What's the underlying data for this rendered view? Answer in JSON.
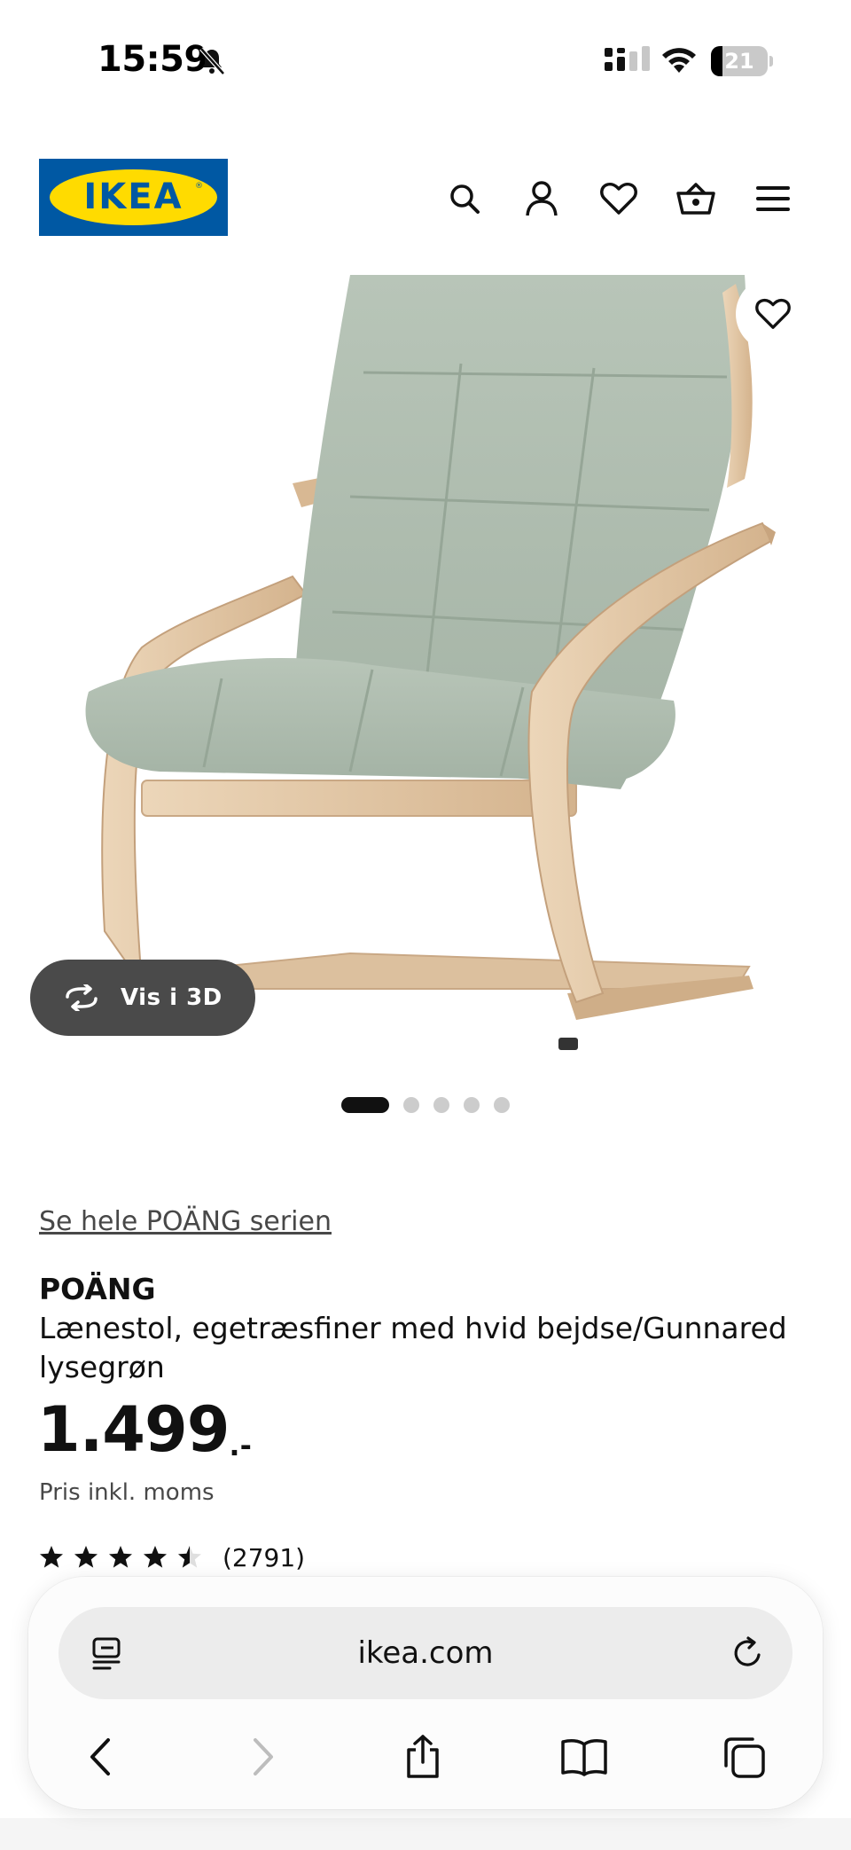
{
  "status_bar": {
    "time": "15:59",
    "battery": "21",
    "battery_level": 0.21,
    "icons": [
      "bell-off-icon",
      "cellular-signal-icon",
      "wifi-icon",
      "battery-icon"
    ]
  },
  "header": {
    "logo_text": "IKEA",
    "logo_registered": "®",
    "icons": [
      "search-icon",
      "account-icon",
      "heart-icon",
      "basket-icon",
      "menu-icon"
    ]
  },
  "gallery": {
    "view_3d_label": "Vis i 3D",
    "image_count": 5,
    "active_index": 0
  },
  "product": {
    "series_link": "Se hele POÄNG serien",
    "name": "POÄNG",
    "description": "Lænestol, egetræsfiner med hvid bejdse/Gunnared lysegrøn",
    "price": "1.499",
    "price_suffix": ".-",
    "vat_note": "Pris inkl. moms",
    "rating_value": 4.5,
    "rating_max": 5,
    "review_count": "(2791)"
  },
  "browser": {
    "url": "ikea.com",
    "nav_icons": [
      "back-icon",
      "forward-icon",
      "share-icon",
      "bookmarks-icon",
      "tabs-icon"
    ]
  },
  "colors": {
    "ikea_blue": "#0058a3",
    "ikea_yellow": "#ffdb00",
    "cushion": "#aebcaf",
    "wood": "#dfc3a2",
    "pill": "#4a4a4a"
  }
}
